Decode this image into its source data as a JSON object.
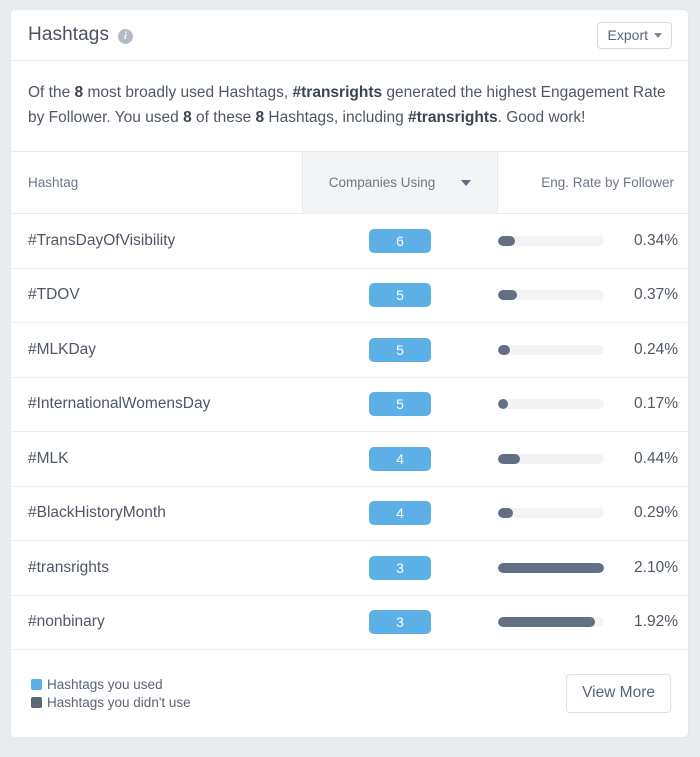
{
  "card": {
    "title": "Hashtags",
    "info_icon": "info-icon",
    "export_label": "Export"
  },
  "summary": {
    "part1": "Of the ",
    "count_total_bold": "8",
    "part2": " most broadly used Hashtags, ",
    "top_hashtag_bold": "#transrights",
    "part3": " generated the highest Engagement Rate by Follower. You used ",
    "used_bold": "8",
    "part4": " of these ",
    "total_bold": "8",
    "part5": " Hashtags, including ",
    "including_bold": "#transrights",
    "part6": ". Good work!"
  },
  "table": {
    "columns": {
      "hashtag": "Hashtag",
      "companies_using": "Companies Using",
      "eng_rate": "Eng. Rate by Follower"
    },
    "sort": {
      "active_column": "Companies Using",
      "direction": "descending",
      "icon": "caret-down-icon"
    },
    "rows": [
      {
        "hashtag": "#TransDayOfVisibility",
        "companies": "6",
        "eng_rate": "0.34%",
        "bar_pct": 16.2,
        "used": true
      },
      {
        "hashtag": "#TDOV",
        "companies": "5",
        "eng_rate": "0.37%",
        "bar_pct": 17.6,
        "used": true
      },
      {
        "hashtag": "#MLKDay",
        "companies": "5",
        "eng_rate": "0.24%",
        "bar_pct": 11.4,
        "used": true
      },
      {
        "hashtag": "#InternationalWomensDay",
        "companies": "5",
        "eng_rate": "0.17%",
        "bar_pct": 9.0,
        "used": true
      },
      {
        "hashtag": "#MLK",
        "companies": "4",
        "eng_rate": "0.44%",
        "bar_pct": 21.0,
        "used": true
      },
      {
        "hashtag": "#BlackHistoryMonth",
        "companies": "4",
        "eng_rate": "0.29%",
        "bar_pct": 13.8,
        "used": true
      },
      {
        "hashtag": "#transrights",
        "companies": "3",
        "eng_rate": "2.10%",
        "bar_pct": 100,
        "used": true
      },
      {
        "hashtag": "#nonbinary",
        "companies": "3",
        "eng_rate": "1.92%",
        "bar_pct": 91.4,
        "used": true
      }
    ]
  },
  "legend": [
    {
      "label": "Hashtags you used",
      "color": "#5cb0e5"
    },
    {
      "label": "Hashtags you didn't use",
      "color": "#5e6775"
    }
  ],
  "footer": {
    "view_more_label": "View More"
  },
  "chart_data": {
    "type": "bar",
    "title": "Hashtags",
    "xlabel": "",
    "ylabel": "Eng. Rate by Follower",
    "categories": [
      "#TransDayOfVisibility",
      "#TDOV",
      "#MLKDay",
      "#InternationalWomensDay",
      "#MLK",
      "#BlackHistoryMonth",
      "#transrights",
      "#nonbinary"
    ],
    "series": [
      {
        "name": "Companies Using",
        "values": [
          6,
          5,
          5,
          5,
          4,
          4,
          3,
          3
        ]
      },
      {
        "name": "Eng. Rate by Follower (%)",
        "values": [
          0.34,
          0.37,
          0.24,
          0.17,
          0.44,
          0.29,
          2.1,
          1.92
        ]
      }
    ],
    "ylim": [
      0,
      2.1
    ],
    "grid": false,
    "legend_position": "bottom-left"
  }
}
